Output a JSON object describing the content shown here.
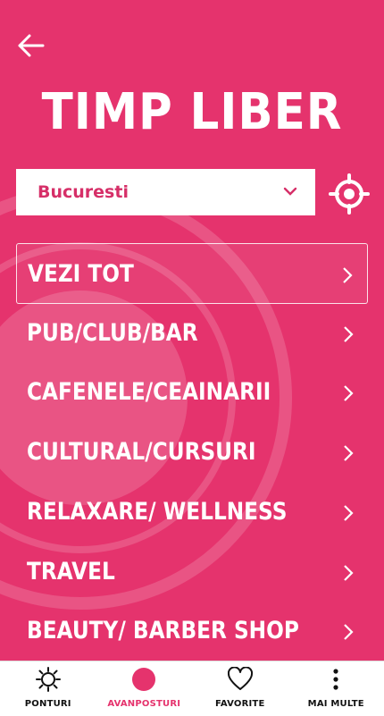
{
  "header": {
    "title": "TIMP LIBER"
  },
  "city_select": {
    "value": "Bucuresti"
  },
  "categories": [
    {
      "label": "VEZI TOT",
      "active": true
    },
    {
      "label": "PUB/CLUB/BAR"
    },
    {
      "label": "CAFENELE/CEAINARII"
    },
    {
      "label": "CULTURAL/CURSURI"
    },
    {
      "label": "RELAXARE/ WELLNESS"
    },
    {
      "label": "TRAVEL"
    },
    {
      "label": "BEAUTY/ BARBER SHOP"
    }
  ],
  "tabbar": {
    "tabs": [
      {
        "label": "PONTURI",
        "icon": "sun-icon"
      },
      {
        "label": "AVANPOSTURI",
        "icon": "circle-icon",
        "active": true
      },
      {
        "label": "FAVORITE",
        "icon": "heart-icon"
      },
      {
        "label": "MAI MULTE",
        "icon": "more-vertical-icon"
      }
    ]
  },
  "colors": {
    "background": "#e5336d",
    "accent": "#e5336d",
    "select_text": "#d62f68"
  }
}
